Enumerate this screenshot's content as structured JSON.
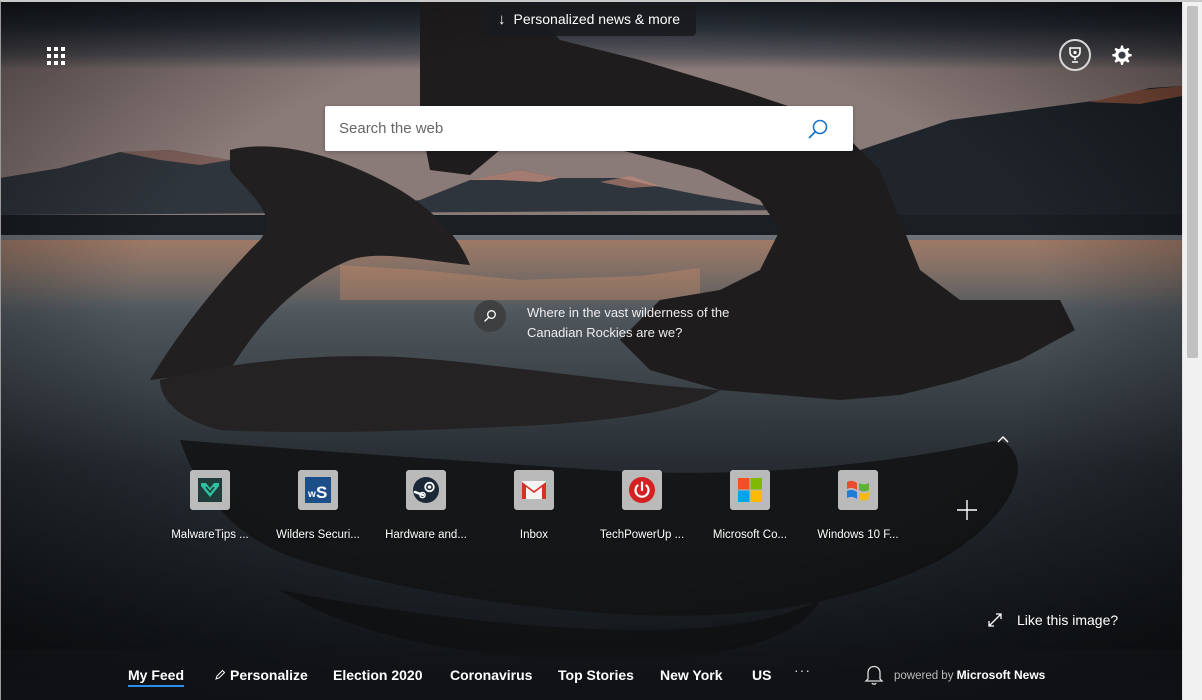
{
  "header": {
    "news_button_label": "Personalized news & more"
  },
  "search": {
    "placeholder": "Search the web"
  },
  "image_info": {
    "question": "Where in the vast wilderness of the Canadian Rockies are we?"
  },
  "quick_links": [
    {
      "label": "MalwareTips ...",
      "icon": "malwaretips-logo-icon"
    },
    {
      "label": "Wilders Securi...",
      "icon": "wilders-security-logo-icon"
    },
    {
      "label": "Hardware and...",
      "icon": "steam-logo-icon"
    },
    {
      "label": "Inbox",
      "icon": "gmail-logo-icon"
    },
    {
      "label": "TechPowerUp ...",
      "icon": "techpowerup-logo-icon"
    },
    {
      "label": "Microsoft Co...",
      "icon": "microsoft-logo-icon"
    },
    {
      "label": "Windows 10 F...",
      "icon": "windows-logo-icon"
    }
  ],
  "like_image": {
    "label": "Like this image?"
  },
  "feed_nav": {
    "items": [
      "My Feed",
      "Personalize",
      "Election 2020",
      "Coronavirus",
      "Top Stories",
      "New York",
      "US"
    ],
    "more": "···",
    "powered_prefix": "powered by",
    "powered_brand": "Microsoft News"
  },
  "colors": {
    "accent": "#2c8df0",
    "search_icon": "#1a73c8"
  }
}
